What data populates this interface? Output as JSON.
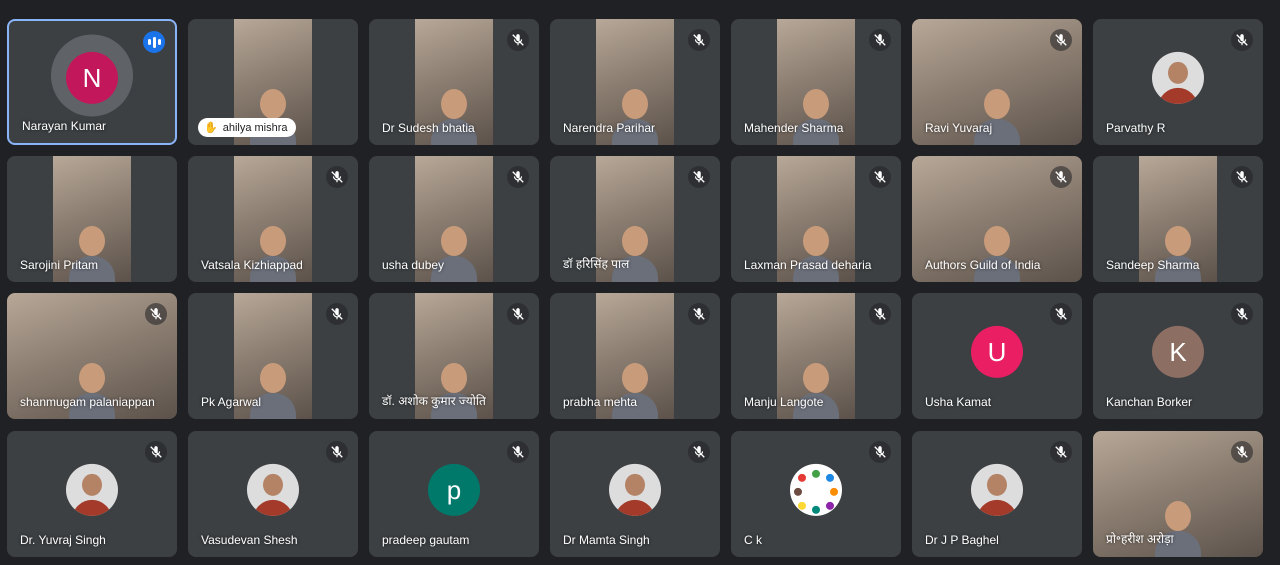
{
  "participants": [
    {
      "name": "Narayan Kumar",
      "avatar_letter": "N",
      "avatar_color": "#c2185b",
      "kind": "letter",
      "active": true,
      "speaking": true,
      "mic_muted": false
    },
    {
      "name": "ahilya mishra",
      "kind": "video",
      "video": "center",
      "chip": true,
      "mic_muted": false
    },
    {
      "name": "Dr Sudesh bhatia",
      "kind": "video",
      "video": "center",
      "mic_muted": true
    },
    {
      "name": "Narendra Parihar",
      "kind": "video",
      "video": "center",
      "mic_muted": true
    },
    {
      "name": "Mahender Sharma",
      "kind": "video",
      "video": "center",
      "mic_muted": true
    },
    {
      "name": "Ravi Yuvaraj",
      "kind": "video",
      "video": "full",
      "mic_muted": true
    },
    {
      "name": "Parvathy R",
      "kind": "photo",
      "mic_muted": true
    },
    {
      "name": "Sarojini Pritam",
      "kind": "video",
      "video": "center",
      "mic_muted": false
    },
    {
      "name": "Vatsala Kizhiappad",
      "kind": "video",
      "video": "center",
      "mic_muted": true
    },
    {
      "name": "usha dubey",
      "kind": "video",
      "video": "center",
      "mic_muted": true
    },
    {
      "name": "डॉ हरिसिंह पाल",
      "kind": "video",
      "video": "center",
      "mic_muted": true
    },
    {
      "name": "Laxman Prasad deharia",
      "kind": "video",
      "video": "center",
      "mic_muted": true
    },
    {
      "name": "Authors Guild of India",
      "kind": "video",
      "video": "full",
      "mic_muted": true
    },
    {
      "name": "Sandeep Sharma",
      "kind": "video",
      "video": "center",
      "mic_muted": true
    },
    {
      "name": "shanmugam palaniappan",
      "kind": "video",
      "video": "full",
      "mic_muted": true
    },
    {
      "name": "Pk Agarwal",
      "kind": "video",
      "video": "center",
      "mic_muted": true
    },
    {
      "name": "डॉ. अशोक कुमार ज्योति",
      "kind": "video",
      "video": "center",
      "mic_muted": true
    },
    {
      "name": "prabha mehta",
      "kind": "video",
      "video": "center",
      "mic_muted": true
    },
    {
      "name": "Manju Langote",
      "kind": "video",
      "video": "center",
      "mic_muted": true
    },
    {
      "name": "Usha Kamat",
      "avatar_letter": "U",
      "avatar_color": "#e91e63",
      "kind": "letter",
      "mic_muted": true
    },
    {
      "name": "Kanchan Borker",
      "avatar_letter": "K",
      "avatar_color": "#8d6e63",
      "kind": "letter",
      "mic_muted": true
    },
    {
      "name": "Dr. Yuvraj Singh",
      "kind": "photo",
      "mic_muted": true
    },
    {
      "name": "Vasudevan Shesh",
      "kind": "photo",
      "mic_muted": true
    },
    {
      "name": "pradeep gautam",
      "avatar_letter": "p",
      "avatar_color": "#00796b",
      "kind": "letter",
      "mic_muted": true
    },
    {
      "name": "Dr Mamta Singh",
      "kind": "photo",
      "mic_muted": true
    },
    {
      "name": "C k",
      "kind": "diagram",
      "mic_muted": true
    },
    {
      "name": "Dr J P Baghel",
      "kind": "photo",
      "mic_muted": true
    },
    {
      "name": "प्रो॰हरीश अरोड़ा",
      "kind": "video",
      "video": "full",
      "mic_muted": true
    }
  ]
}
